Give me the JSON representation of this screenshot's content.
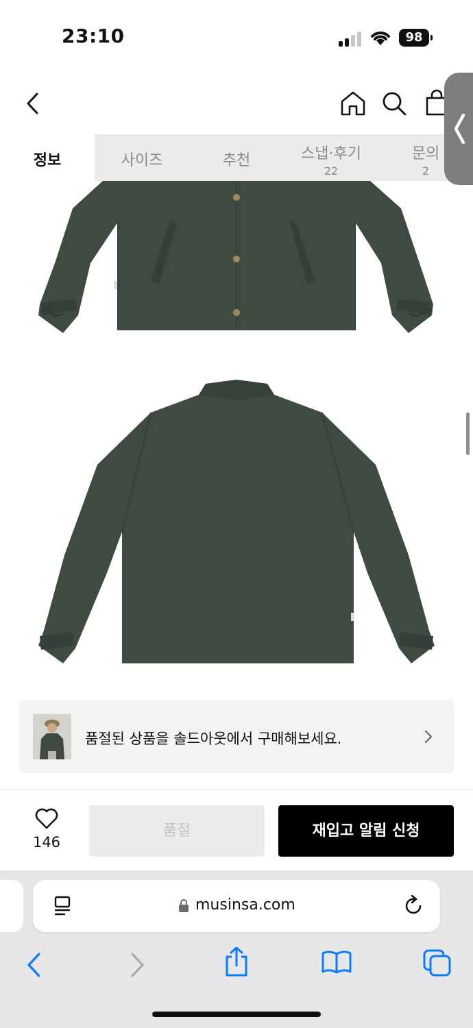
{
  "status_bar": {
    "time": "23:10",
    "battery": "98"
  },
  "header": {
    "back_icon": "chevron-left-icon",
    "home_icon": "home-icon",
    "search_icon": "search-icon",
    "cart_icon": "shopping-bag-icon"
  },
  "tabs": [
    {
      "label": "정보",
      "count": "",
      "active": true
    },
    {
      "label": "사이즈",
      "count": ""
    },
    {
      "label": "추천",
      "count": ""
    },
    {
      "label": "스냅·후기",
      "count": "22"
    },
    {
      "label": "문의",
      "count": "2"
    }
  ],
  "product": {
    "jacket_color": "#3f4a40"
  },
  "soldout_banner": {
    "text": "품절된 상품을 솔드아웃에서 구매해보세요.",
    "icon": "chevron-right-icon"
  },
  "actions": {
    "like_icon": "heart-icon",
    "like_count": "146",
    "soldout_label": "품절",
    "restock_label": "재입고 알림 신청"
  },
  "browser": {
    "url": "musinsa.com",
    "toolbar": [
      "back-icon",
      "forward-icon",
      "share-icon",
      "bookmarks-icon",
      "tabs-icon"
    ]
  },
  "colors": {
    "accent_blue": "#0a7aff",
    "primary_button": "#000000"
  }
}
